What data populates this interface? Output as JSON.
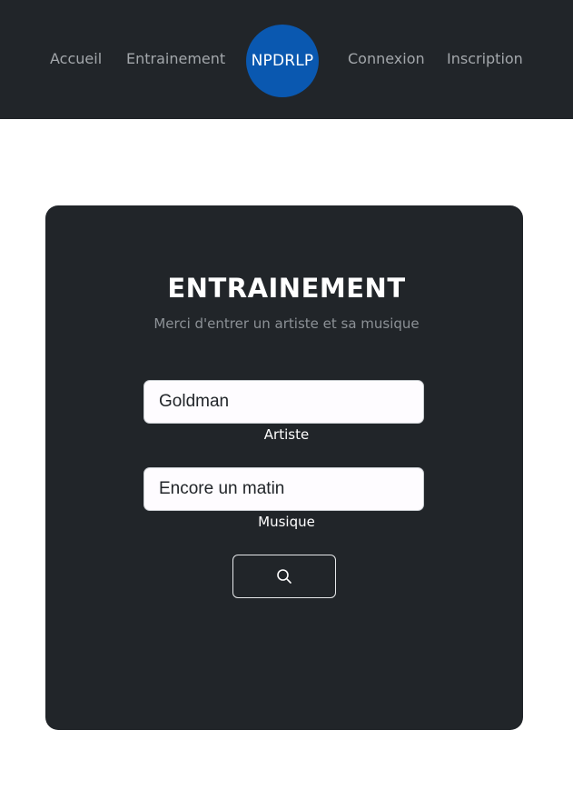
{
  "navbar": {
    "links": [
      "Accueil",
      "Entrainement",
      "Connexion",
      "Inscription"
    ],
    "logo_text": "NPDRLP",
    "colors": {
      "background": "#212529",
      "link": "#a3a7ab",
      "logo": "#0a58b0"
    }
  },
  "form": {
    "title": "ENTRAINEMENT",
    "subtitle": "Merci d'entrer un artiste et sa musique",
    "artist": {
      "value": "Goldman",
      "label": "Artiste"
    },
    "music": {
      "value": "Encore un matin",
      "label": "Musique"
    },
    "search_button_icon": "search-icon",
    "colors": {
      "card": "#212529",
      "title": "#ffffff",
      "subtitle": "#8c9196"
    }
  }
}
